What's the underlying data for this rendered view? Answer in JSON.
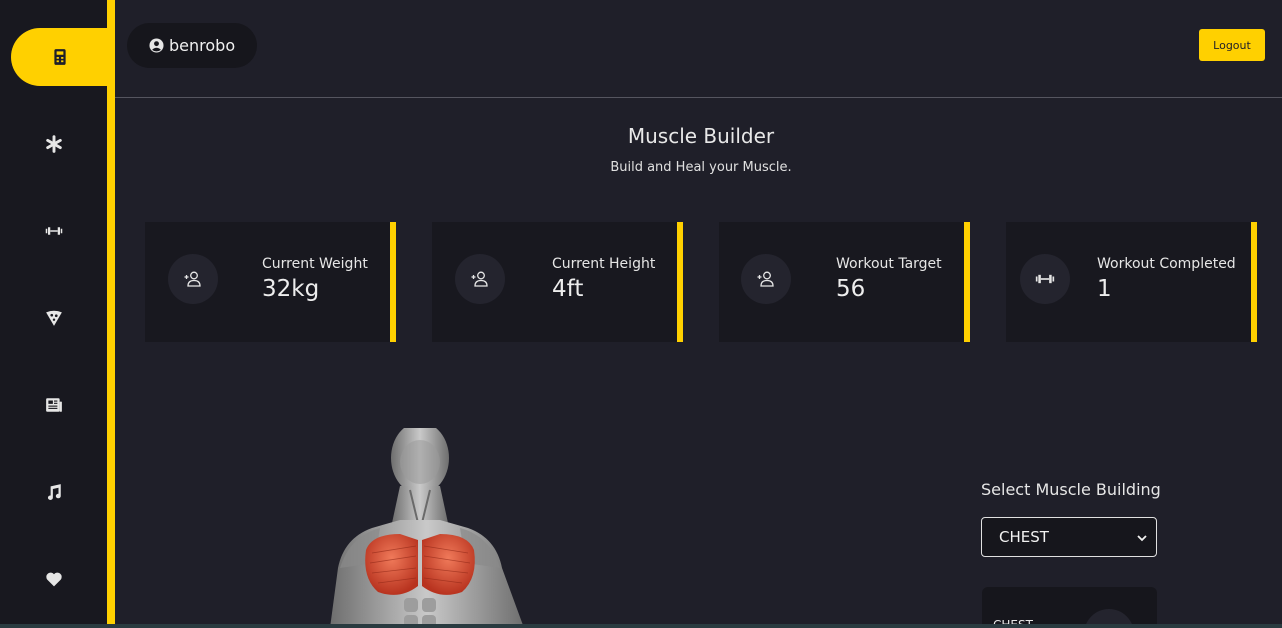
{
  "sidebar": {
    "items": [
      {
        "icon": "calculator-icon",
        "active": true
      },
      {
        "icon": "asterisk-icon",
        "active": false
      },
      {
        "icon": "dumbbell-icon",
        "active": false
      },
      {
        "icon": "pizza-icon",
        "active": false
      },
      {
        "icon": "newspaper-icon",
        "active": false
      },
      {
        "icon": "music-icon",
        "active": false
      },
      {
        "icon": "heart-icon",
        "active": false
      }
    ]
  },
  "header": {
    "username": "benrobo",
    "logout_label": "Logout"
  },
  "hero": {
    "title": "Muscle Builder",
    "subtitle": "Build and Heal your Muscle."
  },
  "stats": [
    {
      "label": "Current Weight",
      "value": "32kg",
      "icon": "user-plus-icon"
    },
    {
      "label": "Current Height",
      "value": "4ft",
      "icon": "user-plus-icon"
    },
    {
      "label": "Workout Target",
      "value": "56",
      "icon": "user-plus-icon"
    },
    {
      "label": "Workout Completed",
      "value": "1",
      "icon": "dumbbell-icon"
    }
  ],
  "muscle_select": {
    "label": "Select Muscle Building",
    "selected": "CHEST"
  },
  "exercise_card": {
    "title": "CHEST"
  },
  "colors": {
    "accent": "#ffd000",
    "background": "#1f1f29",
    "sidebar": "#18181f",
    "card": "#18181f"
  }
}
